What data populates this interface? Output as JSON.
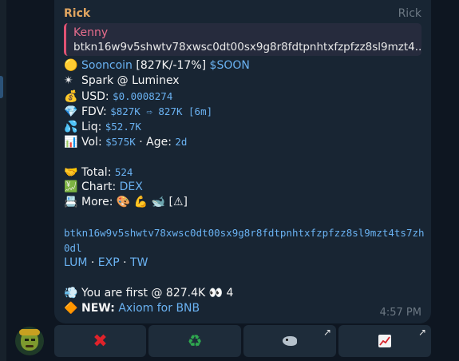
{
  "message": {
    "sender": "Rick",
    "role_label": "Rick",
    "reply": {
      "name": "Kenny",
      "text": "btkn16w9v5shwtv78xwsc0dt00sx9g8r8fdtpnhtxfzpfzz8sl9mzt4..."
    },
    "token": {
      "emoji": "🟡",
      "name": "Sooncoin",
      "stats": "[827K/-17%]",
      "ticker": "$SOON"
    },
    "spark": {
      "emoji": "✴",
      "text": "Spark @ Luminex"
    },
    "usd": {
      "emoji": "💰",
      "label": "USD:",
      "value": "$0.0008274"
    },
    "fdv": {
      "emoji": "💎",
      "label": "FDV:",
      "value": "$827K ⇨ 827K [6m]"
    },
    "liq": {
      "emoji": "💦",
      "label": "Liq:",
      "value": "$52.7K"
    },
    "vol": {
      "emoji": "📊",
      "label": "Vol:",
      "value": "$575K",
      "sep": " · Age: ",
      "age": "2d"
    },
    "total": {
      "emoji": "🤝",
      "label": "Total:",
      "value": "524"
    },
    "chart": {
      "emoji": "💹",
      "label": "Chart:",
      "value": "DEX"
    },
    "more": {
      "emoji": "📇",
      "label": "More:",
      "icons": "🎨 💪 🐋 [⚠]"
    },
    "address": "btkn16w9v5shwtv78xwsc0dt00sx9g8r8fdtpnhtxfzpfzz8sl9mzt4ts7zh0dl",
    "links": {
      "lum": "LUM",
      "exp": "EXP",
      "tw": "TW",
      "sep": " · "
    },
    "first": {
      "emoji": "💨",
      "text": "You are first @ 827.4K",
      "eyes": "👀",
      "count": "4"
    },
    "news": {
      "emoji": "🔶",
      "label": "NEW:",
      "link": "Axiom for BNB"
    },
    "time": "4:57 PM"
  },
  "buttons": {
    "b1": "✖",
    "b2": "♻",
    "arrow": "↗"
  },
  "colors": {
    "background": "#0e1621",
    "bubble": "#182533",
    "link": "#6ab2f2",
    "sender": "#e1a560",
    "reply_accent": "#e05273"
  }
}
